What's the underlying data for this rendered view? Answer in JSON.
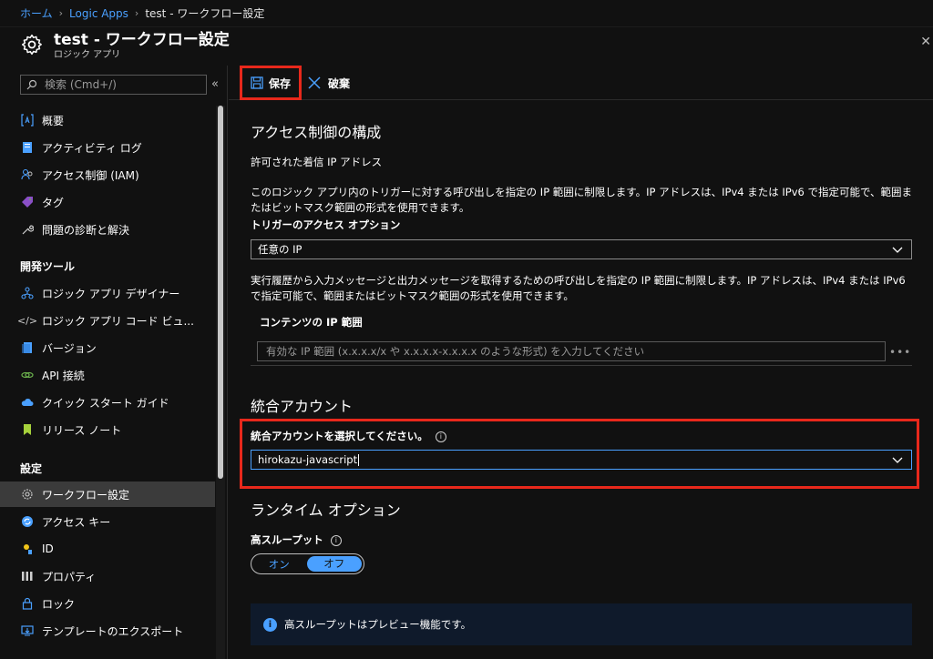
{
  "breadcrumb": {
    "home": "ホーム",
    "logic_apps": "Logic Apps",
    "current": "test - ワークフロー設定"
  },
  "header": {
    "title": "test - ワークフロー設定",
    "subtitle": "ロジック アプリ"
  },
  "sidebar": {
    "search_placeholder": "検索 (Cmd+/)",
    "items_top": [
      {
        "label": "概要",
        "icon": "overview-icon"
      },
      {
        "label": "アクティビティ ログ",
        "icon": "activity-log-icon"
      },
      {
        "label": "アクセス制御 (IAM)",
        "icon": "iam-icon"
      },
      {
        "label": "タグ",
        "icon": "tag-icon"
      },
      {
        "label": "問題の診断と解決",
        "icon": "wrench-icon"
      }
    ],
    "section_dev": "開発ツール",
    "items_dev": [
      {
        "label": "ロジック アプリ デザイナー",
        "icon": "designer-icon"
      },
      {
        "label": "ロジック アプリ コード ビュ...",
        "icon": "code-icon"
      },
      {
        "label": "バージョン",
        "icon": "versions-icon"
      },
      {
        "label": "API 接続",
        "icon": "api-connection-icon"
      },
      {
        "label": "クイック スタート ガイド",
        "icon": "cloud-icon"
      },
      {
        "label": "リリース ノート",
        "icon": "bookmark-icon"
      }
    ],
    "section_settings": "設定",
    "items_settings": [
      {
        "label": "ワークフロー設定",
        "icon": "gear-icon"
      },
      {
        "label": "アクセス キー",
        "icon": "refresh-key-icon"
      },
      {
        "label": "ID",
        "icon": "identity-icon"
      },
      {
        "label": "プロパティ",
        "icon": "properties-icon"
      },
      {
        "label": "ロック",
        "icon": "lock-icon"
      },
      {
        "label": "テンプレートのエクスポート",
        "icon": "export-icon"
      }
    ]
  },
  "toolbar": {
    "save": "保存",
    "discard": "破棄"
  },
  "main": {
    "access_title": "アクセス制御の構成",
    "allowed_ip_label": "許可された着信 IP アドレス",
    "trigger_desc": "このロジック アプリ内のトリガーに対する呼び出しを指定の IP 範囲に制限します。IP アドレスは、IPv4 または IPv6 で指定可能で、範囲またはビットマスク範囲の形式を使用できます。",
    "trigger_option_label": "トリガーのアクセス オプション",
    "trigger_option_value": "任意の IP",
    "content_desc": "実行履歴から入力メッセージと出力メッセージを取得するための呼び出しを指定の IP 範囲に制限します。IP アドレスは、IPv4 または IPv6 で指定可能で、範囲またはビットマスク範囲の形式を使用できます。",
    "content_ip_label": "コンテンツの IP 範囲",
    "content_ip_placeholder": "有効な IP 範囲 (x.x.x.x/x や x.x.x.x-x.x.x.x のような形式) を入力してください",
    "integration_title": "統合アカウント",
    "integration_label": "統合アカウントを選択してください。",
    "integration_value": "hirokazu-javascript",
    "runtime_title": "ランタイム オプション",
    "throughput_label": "高スループット",
    "toggle_on": "オン",
    "toggle_off": "オフ",
    "banner": "高スループットはプレビュー機能です。"
  },
  "colors": {
    "accent": "#4aa0ff",
    "highlight": "#e8281b",
    "background": "#111111"
  }
}
